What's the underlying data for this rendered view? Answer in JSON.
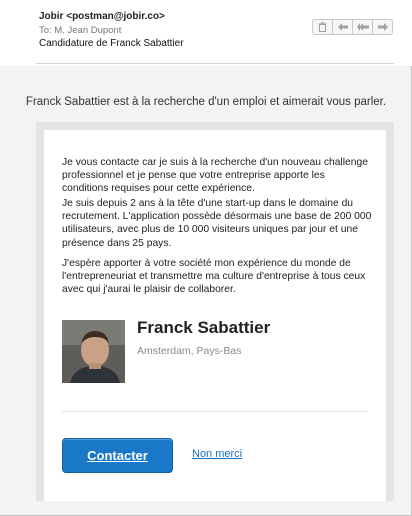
{
  "header": {
    "from": "Jobir <postman@jobir.co>",
    "to": "To:  M. Jean Dupont",
    "subject": "Candidature de Franck Sabattier"
  },
  "toolbar": {
    "buttons": [
      "trash-icon",
      "reply-icon",
      "reply-all-icon",
      "forward-icon"
    ]
  },
  "tagline": "Franck Sabattier est à la recherche d'un emploi et aimerait vous parler.",
  "body": {
    "paragraph1": "Je vous contacte car je suis à la recherche d'un nouveau challenge professionnel et je pense que votre entreprise apporte les conditions requises pour cette expérience.",
    "paragraph2": "Je suis depuis 2 ans à la tête d'une start-up dans le domaine du recrutement. L'application possède désormais une base de 200 000 utilisateurs, avec plus de 10 000 visiteurs uniques par jour et une présence dans 25 pays.",
    "paragraph3": "J'espère apporter à votre société mon expérience du monde de l'entrepreneuriat et transmettre ma culture d'entreprise à tous ceux avec qui j'aurai le plaisir de collaborer."
  },
  "profile": {
    "name": "Franck Sabattier",
    "location": "Amsterdam, Pays-Bas"
  },
  "actions": {
    "contact_label": "Contacter",
    "decline_label": "Non merci"
  },
  "colors": {
    "accent": "#1a78c9",
    "link": "#1a6fc0"
  }
}
